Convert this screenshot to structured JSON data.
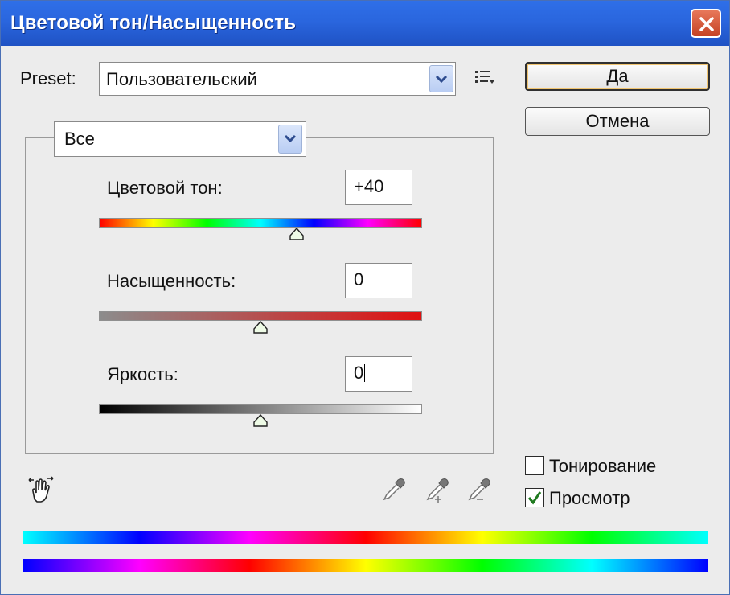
{
  "window": {
    "title": "Цветовой тон/Насыщенность"
  },
  "preset": {
    "label": "Preset:",
    "value": "Пользовательский"
  },
  "buttons": {
    "ok": "Да",
    "cancel": "Отмена"
  },
  "channel": {
    "value": "Все"
  },
  "sliders": [
    {
      "label": "Цветовой тон:",
      "value": "+40",
      "amount": 40,
      "min": -180,
      "max": 180
    },
    {
      "label": "Насыщенность:",
      "value": "0",
      "amount": 0,
      "min": -100,
      "max": 100
    },
    {
      "label": "Яркость:",
      "value": "0",
      "amount": 0,
      "min": -100,
      "max": 100
    }
  ],
  "options": {
    "colorize": {
      "label": "Тонирование",
      "checked": false
    },
    "preview": {
      "label": "Просмотр",
      "checked": true
    }
  },
  "icons": {
    "close": "close-icon",
    "dropdown": "chevron-down-icon",
    "preset_menu": "list-menu-icon",
    "hand_tool": "hand-adjust-icon",
    "eyedropper": "eyedropper-icon",
    "eyedropper_add": "eyedropper-plus-icon",
    "eyedropper_subtract": "eyedropper-minus-icon"
  },
  "colors": {
    "titlebar": "#2a66de",
    "close_button": "#d9593a",
    "default_button_glow": "#f0c470"
  }
}
